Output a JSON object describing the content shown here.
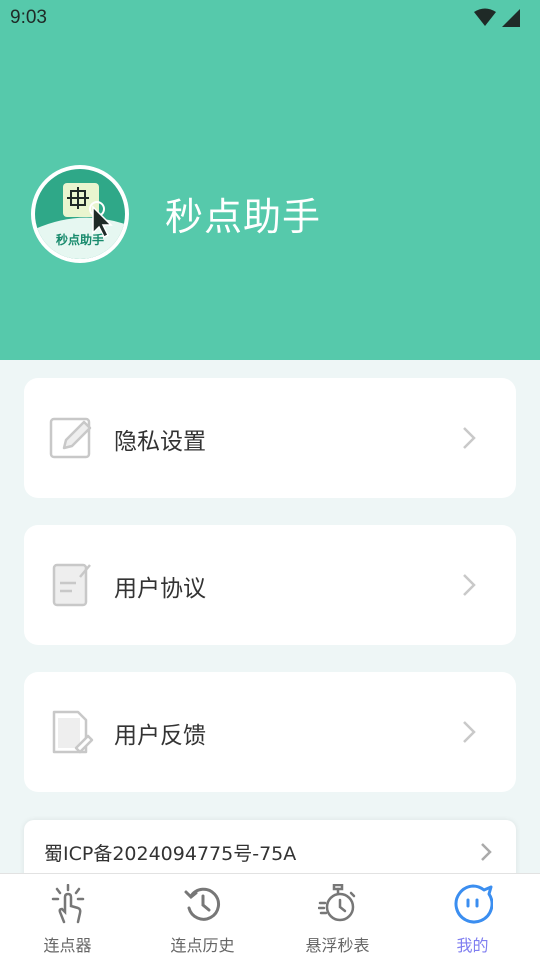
{
  "status_bar": {
    "time": "9:03",
    "icons": [
      "wifi-icon",
      "signal-icon"
    ]
  },
  "profile": {
    "avatar_label": "秒点助手",
    "app_name": "秒点助手"
  },
  "menu": [
    {
      "label": "隐私设置",
      "icon": "edit-icon"
    },
    {
      "label": "用户协议",
      "icon": "document-icon"
    },
    {
      "label": "用户反馈",
      "icon": "feedback-icon"
    }
  ],
  "icp": {
    "label": "蜀ICP备2024094775号-75A"
  },
  "tabs": [
    {
      "label": "连点器",
      "icon": "tap-icon"
    },
    {
      "label": "连点历史",
      "icon": "history-icon"
    },
    {
      "label": "悬浮秒表",
      "icon": "stopwatch-icon"
    },
    {
      "label": "我的",
      "icon": "face-icon",
      "active": true
    }
  ],
  "colors": {
    "header": "#56c9ab",
    "background": "#eef6f6",
    "active_tab": "#7f7ef0"
  }
}
